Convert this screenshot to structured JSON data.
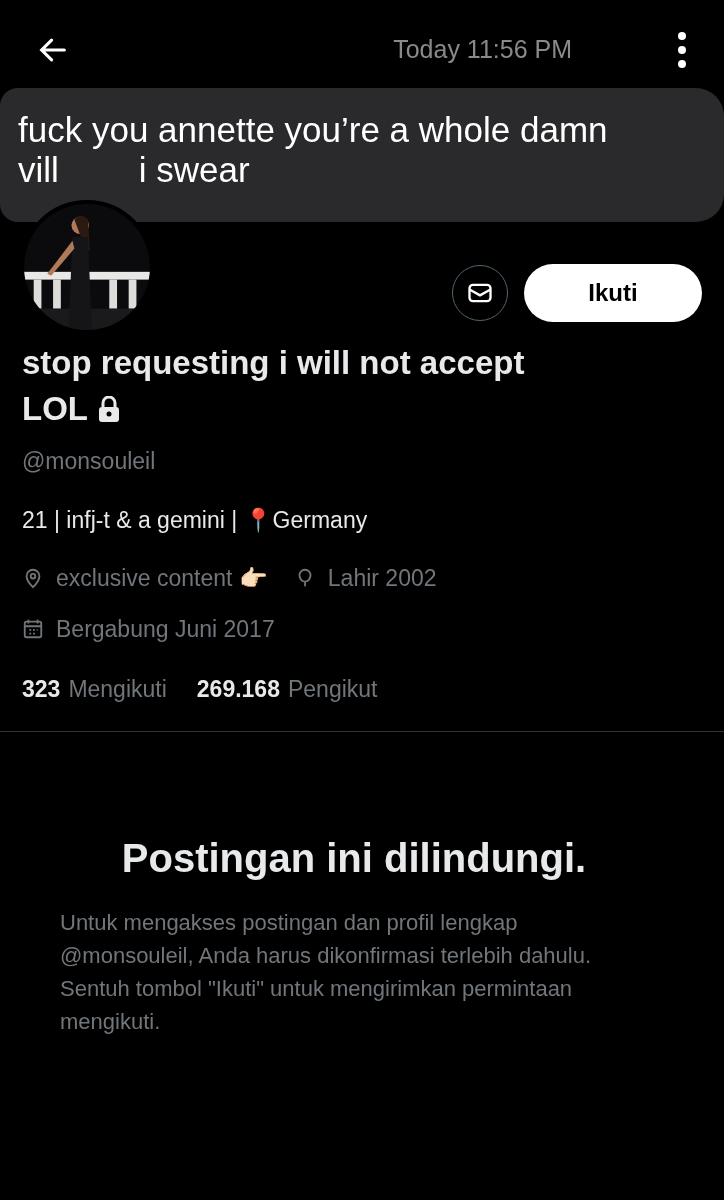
{
  "header": {
    "timestamp": "Today 11:56 PM"
  },
  "message": {
    "line_1": "fuck you annette you’re a whole damn",
    "line_2_start": "vill",
    "line_2_end": "i swear"
  },
  "profile": {
    "follow_button": "Ikuti",
    "display_name_line_1": "stop requesting i will not accept",
    "display_name_line_2": "LOL",
    "protected": true,
    "handle": "@monsouleil",
    "bio": "21 | infj-t & a gemini | 📍Germany",
    "meta": [
      {
        "kind": "location",
        "text": "exclusive content 👉🏻"
      },
      {
        "kind": "birthday",
        "text": "Lahir 2002"
      },
      {
        "kind": "joined",
        "text": "Bergabung Juni 2017"
      }
    ],
    "stats": [
      {
        "count": "323",
        "label": "Mengikuti"
      },
      {
        "count": "269.168",
        "label": "Pengikut"
      }
    ]
  },
  "protected_notice": {
    "title": "Postingan ini dilindungi.",
    "body": "Untuk mengakses postingan dan profil lengkap @monsouleil, Anda harus dikonfirmasi terlebih dahulu. Sentuh tombol \"Ikuti\" untuk mengirimkan permintaan mengikuti."
  }
}
